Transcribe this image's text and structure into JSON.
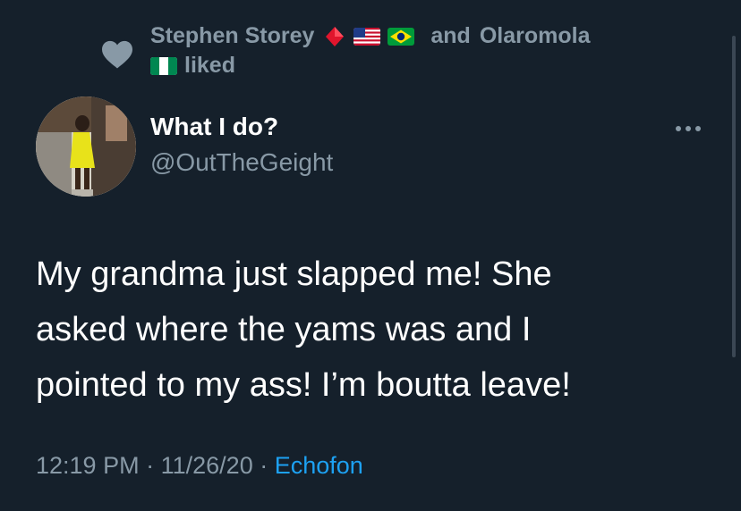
{
  "context": {
    "icon": "heart-icon",
    "user1_name": "Stephen Storey",
    "connector": "and",
    "user2_name": "Olaromola",
    "action": "liked",
    "emojis": [
      "red-diamond-icon",
      "us-flag-icon",
      "brazil-flag-icon",
      "nigeria-flag-icon"
    ]
  },
  "tweet": {
    "author_name": "What I do?",
    "author_handle": "@OutTheGeight",
    "text": "My grandma just slapped me! She\nasked where the yams was and I\npointed to my ass! I’m boutta leave!",
    "time": "12:19 PM",
    "separator": "·",
    "date": "11/26/20",
    "source": "Echofon"
  },
  "colors": {
    "background": "#15202b",
    "secondary_text": "#8899a6",
    "link": "#1da1f2",
    "primary_text": "#ffffff"
  }
}
